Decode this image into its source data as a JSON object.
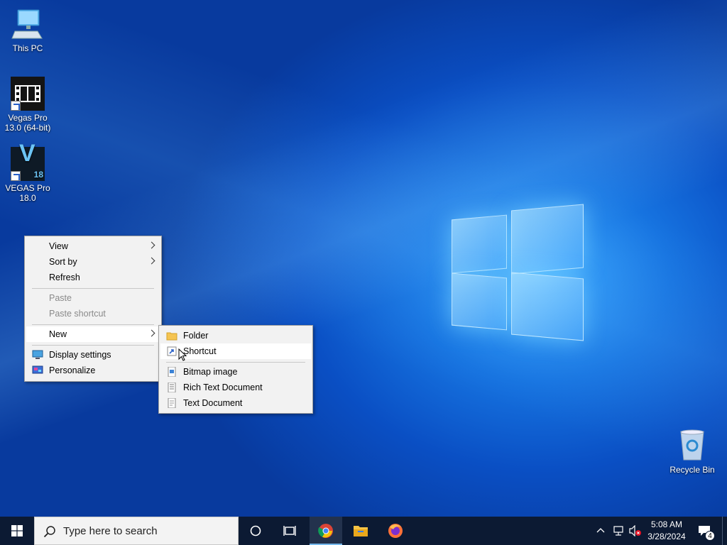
{
  "desktop": {
    "icons": [
      {
        "label": "This PC"
      },
      {
        "label": "Vegas Pro 13.0 (64-bit)"
      },
      {
        "label": "VEGAS Pro 18.0"
      },
      {
        "label": "Recycle Bin"
      }
    ],
    "vegas18_badge": "V",
    "vegas18_version": "18"
  },
  "context_menu": {
    "items": [
      {
        "label": "View",
        "has_submenu": true,
        "enabled": true
      },
      {
        "label": "Sort by",
        "has_submenu": true,
        "enabled": true
      },
      {
        "label": "Refresh",
        "enabled": true
      },
      {
        "label": "Paste",
        "enabled": false
      },
      {
        "label": "Paste shortcut",
        "enabled": false
      },
      {
        "label": "New",
        "has_submenu": true,
        "enabled": true,
        "highlighted": true
      },
      {
        "label": "Display settings",
        "icon": "display-icon",
        "enabled": true
      },
      {
        "label": "Personalize",
        "icon": "personalize-icon",
        "enabled": true
      }
    ]
  },
  "new_submenu": {
    "items": [
      {
        "label": "Folder",
        "icon": "folder-icon"
      },
      {
        "label": "Shortcut",
        "icon": "shortcut-icon",
        "hovered": true
      },
      {
        "label": "Bitmap image",
        "icon": "bitmap-icon"
      },
      {
        "label": "Rich Text Document",
        "icon": "rtf-icon"
      },
      {
        "label": "Text Document",
        "icon": "text-document-icon"
      }
    ]
  },
  "taskbar": {
    "search_placeholder": "Type here to search",
    "pinned": [
      "cortana-icon",
      "task-view-icon",
      "chrome-icon",
      "file-explorer-icon",
      "firefox-icon"
    ],
    "clock_time": "5:08 AM",
    "clock_date": "3/28/2024",
    "notification_count": "4"
  },
  "colors": {
    "taskbar": "#0c1a33",
    "menu_bg": "#f2f2f2",
    "accent": "#1673e0"
  }
}
